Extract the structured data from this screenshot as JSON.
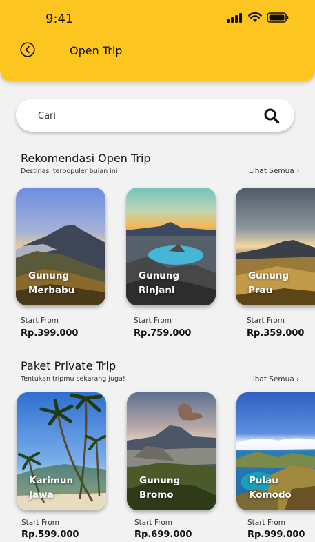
{
  "status_bar": {
    "time": "9:41"
  },
  "header": {
    "title": "Open Trip"
  },
  "search": {
    "placeholder": "Cari"
  },
  "open_trip": {
    "title": "Rekomendasi Open Trip",
    "subtitle": "Destinasi terpopuler bulan ini",
    "see_all": "Lihat Semua ›",
    "cards": [
      {
        "name_line1": "Gunung",
        "name_line2": "Merbabu",
        "start_label": "Start From",
        "price": "Rp.399.000"
      },
      {
        "name_line1": "Gunung",
        "name_line2": "Rinjani",
        "start_label": "Start From",
        "price": "Rp.759.000"
      },
      {
        "name_line1": "Gunung",
        "name_line2": "Prau",
        "start_label": "Start From",
        "price": "Rp.359.000"
      }
    ]
  },
  "private_trip": {
    "title": "Paket Private Trip",
    "subtitle": "Tentukan tripmu sekarang juga!",
    "see_all": "Lihat Semua ›",
    "cards": [
      {
        "name_line1": "Karimun",
        "name_line2": "Jawa",
        "start_label": "Start From",
        "price": "Rp.599.000"
      },
      {
        "name_line1": "Gunung",
        "name_line2": "Bromo",
        "start_label": "Start From",
        "price": "Rp.699.000"
      },
      {
        "name_line1": "Pulau",
        "name_line2": "Komodo",
        "start_label": "Start From",
        "price": "Rp.999.000"
      }
    ]
  },
  "colors": {
    "header": "#fcc51f",
    "background": "#f2f2f2",
    "card_text": "#ffffff"
  }
}
